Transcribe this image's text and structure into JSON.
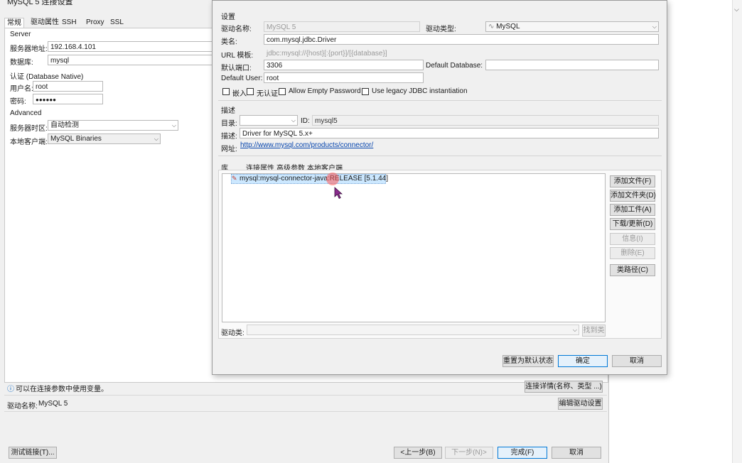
{
  "main_dialog": {
    "title": "MySQL 5 连接设置",
    "tabs": [
      "常规",
      "驱动属性",
      "SSH",
      "Proxy",
      "SSL"
    ],
    "server_section": "Server",
    "host_label": "服务器地址:",
    "host_value": "192.168.4.101",
    "database_label": "数据库:",
    "database_value": "mysql",
    "auth_section": "认证 (Database Native)",
    "user_label": "用户名:",
    "user_value": "root",
    "password_label": "密码:",
    "password_value": "●●●●●●",
    "advanced_section": "Advanced",
    "timezone_label": "服务器时区:",
    "timezone_value": "自动检测",
    "client_label": "本地客户端:",
    "client_value": "MySQL Binaries",
    "info_text": "可以在连接参数中使用变量。",
    "info_icon": "ⓘ",
    "conn_details_button": "连接详情(名称、类型 ...)",
    "driver_name_label": "驱动名称:",
    "driver_name_value": "MySQL 5",
    "edit_driver_button": "编辑驱动设置",
    "test_button": "测试链接(T)...",
    "back_button": "<上一步(B)",
    "next_button": "下一步(N)>",
    "finish_button": "完成(F)",
    "cancel_button": "取消"
  },
  "driver_dialog": {
    "settings_section": "设置",
    "driver_name_label": "驱动名称:",
    "driver_name_value": "MySQL 5",
    "driver_type_label": "驱动类型:",
    "driver_type_value": "MySQL",
    "class_label": "类名:",
    "class_value": "com.mysql.jdbc.Driver",
    "url_label": "URL 模板:",
    "url_value": "jdbc:mysql://{host}[:{port}]/[{database}]",
    "port_label": "默认端口:",
    "port_value": "3306",
    "default_db_label": "Default Database:",
    "default_db_value": "",
    "default_user_label": "Default User:",
    "default_user_value": "root",
    "checkboxes": [
      "嵌入",
      "无认证",
      "Allow Empty Password",
      "Use legacy JDBC instantiation"
    ],
    "desc_section": "描述",
    "category_label": "目录:",
    "id_label": "ID:",
    "id_value": "mysql5",
    "desc_label": "描述:",
    "desc_value": "Driver for MySQL 5.x+",
    "website_label": "网址:",
    "website_value": "http://www.mysql.com/products/connector/",
    "lib_tabs": [
      "库",
      "连接属性",
      "高级参数",
      "本地客户端"
    ],
    "library_item": "mysql:mysql-connector-java:RELEASE [5.1.44]",
    "side_buttons": [
      "添加文件(F)",
      "添加文件夹(D)",
      "添加工件(A)",
      "下载/更新(D)",
      "信息(I)",
      "删除(E)",
      "类路径(C)"
    ],
    "driver_class_label": "驱动类:",
    "find_class_button": "找到类",
    "reset_button": "重置为默认状态",
    "ok_button": "确定",
    "cancel_button": "取消"
  },
  "colors": {
    "window_bg": "#f0f0f0",
    "selection_bg": "#cce8ff",
    "link": "#0645ad",
    "default_button_border": "#0078d7",
    "cursor_highlight": "#ff7070"
  }
}
